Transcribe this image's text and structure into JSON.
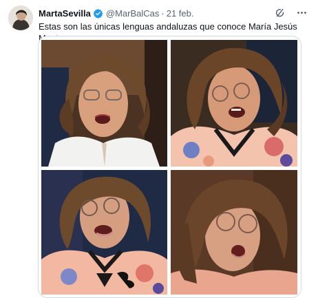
{
  "tweet": {
    "display_name": "MartaSevilla",
    "handle": "@MarBalCas",
    "separator": "·",
    "date": "21 feb.",
    "text": "Estas son las únicas lenguas andaluzas que conoce María Jesús Montero",
    "verified_color": "#1d9bf0",
    "icons": [
      "verified-badge-icon",
      "grok-icon",
      "more-icon"
    ]
  },
  "media": {
    "layout": "2x2 grid",
    "photos": [
      "photo-top-left",
      "photo-top-right",
      "photo-bottom-left",
      "photo-bottom-right"
    ]
  }
}
